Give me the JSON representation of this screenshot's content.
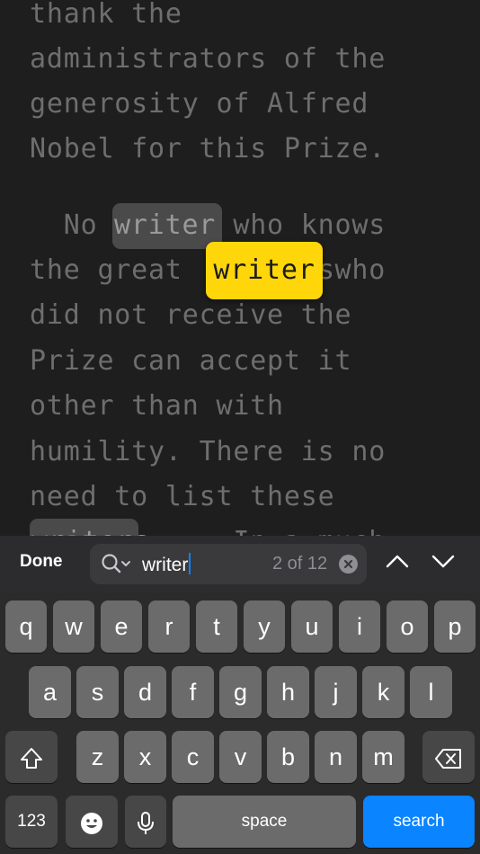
{
  "reader": {
    "lines": [
      "thank the",
      "administrators of the",
      "generosity of Alfred",
      "Nobel for this Prize.",
      "  No        who knows",
      "the great         who",
      "did not receive the",
      "Prize can accept it",
      "other than with",
      "humility. There is no",
      "need to list these",
      "            In a much"
    ],
    "match_dim_1": "writer",
    "match_current": "writer",
    "match_current_suffix": "s",
    "match_dim_3": "writers"
  },
  "findbar": {
    "done_label": "Done",
    "query": "writer",
    "count": "2 of 12"
  },
  "keyboard": {
    "row1": [
      "q",
      "w",
      "e",
      "r",
      "t",
      "y",
      "u",
      "i",
      "o",
      "p"
    ],
    "row2": [
      "a",
      "s",
      "d",
      "f",
      "g",
      "h",
      "j",
      "k",
      "l"
    ],
    "row3": [
      "z",
      "x",
      "c",
      "v",
      "b",
      "n",
      "m"
    ],
    "numbers_label": "123",
    "space_label": "space",
    "search_label": "search"
  }
}
